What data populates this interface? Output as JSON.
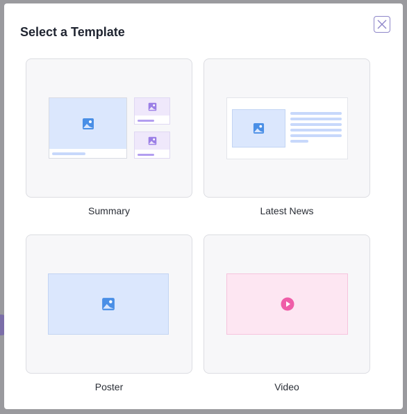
{
  "dialog": {
    "title": "Select a Template",
    "close_icon": "close-icon"
  },
  "templates": [
    {
      "label": "Summary",
      "icon": "image-icon"
    },
    {
      "label": "Latest News",
      "icon": "image-icon"
    },
    {
      "label": "Poster",
      "icon": "image-icon"
    },
    {
      "label": "Video",
      "icon": "play-icon"
    }
  ],
  "colors": {
    "image_blue": "#4a8fe6",
    "image_purple": "#9b7fe6",
    "video_pink": "#ef5da8",
    "accent_border": "#8e86c9"
  }
}
